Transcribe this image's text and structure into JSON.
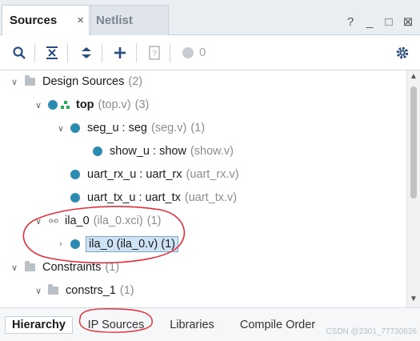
{
  "tabs": [
    {
      "label": "Sources",
      "close": "×"
    },
    {
      "label": "Netlist"
    }
  ],
  "window_controls": [
    "?",
    "_",
    "□",
    "⊠"
  ],
  "toolbar": {
    "error_count": "0"
  },
  "tree": {
    "design_sources": {
      "label": "Design Sources",
      "count": "(2)"
    },
    "top": {
      "label": "top",
      "file": "(top.v)",
      "count": "(3)"
    },
    "seg_u": {
      "label": "seg_u : seg",
      "file": "(seg.v)",
      "count": "(1)"
    },
    "show_u": {
      "label": "show_u : show",
      "file": "(show.v)"
    },
    "uart_rx_u": {
      "label": "uart_rx_u : uart_rx",
      "file": "(uart_rx.v)"
    },
    "uart_tx_u": {
      "label": "uart_tx_u : uart_tx",
      "file": "(uart_tx.v)"
    },
    "ila_0": {
      "label": "ila_0",
      "file": "(ila_0.xci)",
      "count": "(1)"
    },
    "ila_0_v": {
      "label": "ila_0 (ila_0.v) (1)"
    },
    "constraints": {
      "label": "Constraints",
      "count": "(1)"
    },
    "constrs_1": {
      "label": "constrs_1",
      "count": "(1)"
    }
  },
  "bottom_tabs": [
    "Hierarchy",
    "IP Sources",
    "Libraries",
    "Compile Order"
  ],
  "watermark": "CSDN @2301_77730626",
  "colors": {
    "accent_blue": "#2a4d80",
    "module_dot": "#2e8bb0",
    "annotation_red": "#e0303a",
    "selection_bg": "#cfe3f7"
  }
}
